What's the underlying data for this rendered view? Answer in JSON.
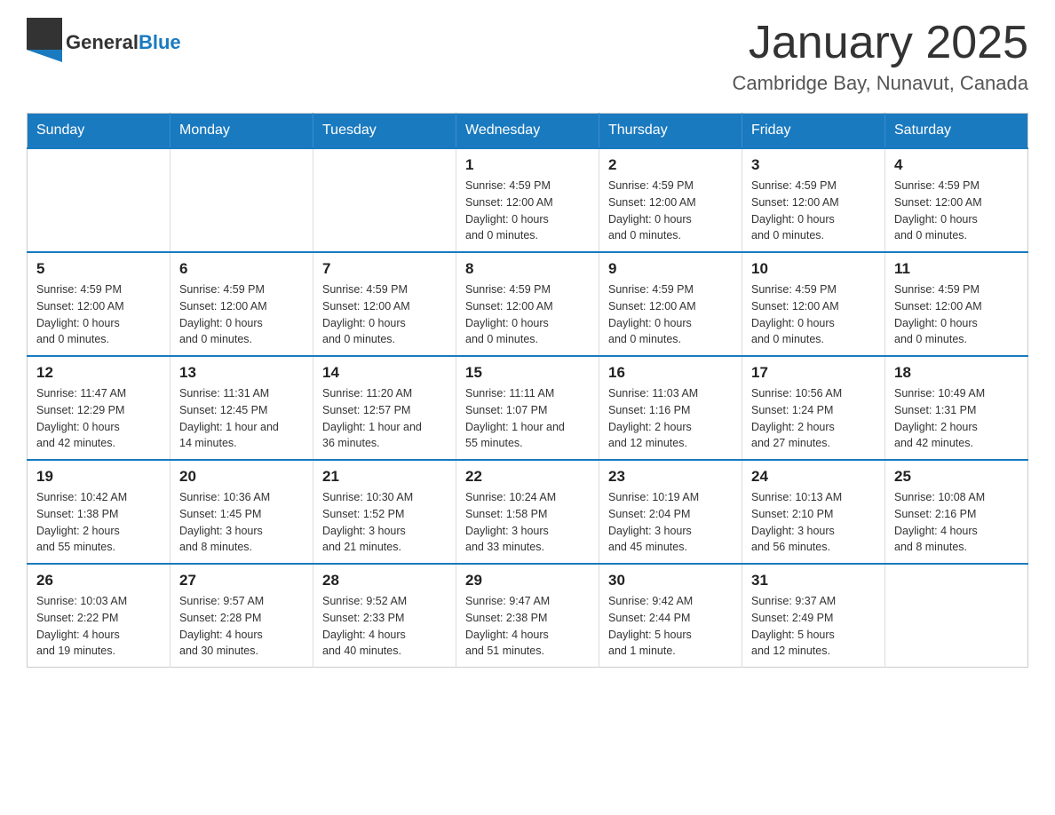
{
  "header": {
    "logo_general": "General",
    "logo_blue": "Blue",
    "title": "January 2025",
    "subtitle": "Cambridge Bay, Nunavut, Canada"
  },
  "weekdays": [
    "Sunday",
    "Monday",
    "Tuesday",
    "Wednesday",
    "Thursday",
    "Friday",
    "Saturday"
  ],
  "weeks": [
    [
      {
        "day": "",
        "info": ""
      },
      {
        "day": "",
        "info": ""
      },
      {
        "day": "",
        "info": ""
      },
      {
        "day": "1",
        "info": "Sunrise: 4:59 PM\nSunset: 12:00 AM\nDaylight: 0 hours\nand 0 minutes."
      },
      {
        "day": "2",
        "info": "Sunrise: 4:59 PM\nSunset: 12:00 AM\nDaylight: 0 hours\nand 0 minutes."
      },
      {
        "day": "3",
        "info": "Sunrise: 4:59 PM\nSunset: 12:00 AM\nDaylight: 0 hours\nand 0 minutes."
      },
      {
        "day": "4",
        "info": "Sunrise: 4:59 PM\nSunset: 12:00 AM\nDaylight: 0 hours\nand 0 minutes."
      }
    ],
    [
      {
        "day": "5",
        "info": "Sunrise: 4:59 PM\nSunset: 12:00 AM\nDaylight: 0 hours\nand 0 minutes."
      },
      {
        "day": "6",
        "info": "Sunrise: 4:59 PM\nSunset: 12:00 AM\nDaylight: 0 hours\nand 0 minutes."
      },
      {
        "day": "7",
        "info": "Sunrise: 4:59 PM\nSunset: 12:00 AM\nDaylight: 0 hours\nand 0 minutes."
      },
      {
        "day": "8",
        "info": "Sunrise: 4:59 PM\nSunset: 12:00 AM\nDaylight: 0 hours\nand 0 minutes."
      },
      {
        "day": "9",
        "info": "Sunrise: 4:59 PM\nSunset: 12:00 AM\nDaylight: 0 hours\nand 0 minutes."
      },
      {
        "day": "10",
        "info": "Sunrise: 4:59 PM\nSunset: 12:00 AM\nDaylight: 0 hours\nand 0 minutes."
      },
      {
        "day": "11",
        "info": "Sunrise: 4:59 PM\nSunset: 12:00 AM\nDaylight: 0 hours\nand 0 minutes."
      }
    ],
    [
      {
        "day": "12",
        "info": "Sunrise: 11:47 AM\nSunset: 12:29 PM\nDaylight: 0 hours\nand 42 minutes."
      },
      {
        "day": "13",
        "info": "Sunrise: 11:31 AM\nSunset: 12:45 PM\nDaylight: 1 hour and\n14 minutes."
      },
      {
        "day": "14",
        "info": "Sunrise: 11:20 AM\nSunset: 12:57 PM\nDaylight: 1 hour and\n36 minutes."
      },
      {
        "day": "15",
        "info": "Sunrise: 11:11 AM\nSunset: 1:07 PM\nDaylight: 1 hour and\n55 minutes."
      },
      {
        "day": "16",
        "info": "Sunrise: 11:03 AM\nSunset: 1:16 PM\nDaylight: 2 hours\nand 12 minutes."
      },
      {
        "day": "17",
        "info": "Sunrise: 10:56 AM\nSunset: 1:24 PM\nDaylight: 2 hours\nand 27 minutes."
      },
      {
        "day": "18",
        "info": "Sunrise: 10:49 AM\nSunset: 1:31 PM\nDaylight: 2 hours\nand 42 minutes."
      }
    ],
    [
      {
        "day": "19",
        "info": "Sunrise: 10:42 AM\nSunset: 1:38 PM\nDaylight: 2 hours\nand 55 minutes."
      },
      {
        "day": "20",
        "info": "Sunrise: 10:36 AM\nSunset: 1:45 PM\nDaylight: 3 hours\nand 8 minutes."
      },
      {
        "day": "21",
        "info": "Sunrise: 10:30 AM\nSunset: 1:52 PM\nDaylight: 3 hours\nand 21 minutes."
      },
      {
        "day": "22",
        "info": "Sunrise: 10:24 AM\nSunset: 1:58 PM\nDaylight: 3 hours\nand 33 minutes."
      },
      {
        "day": "23",
        "info": "Sunrise: 10:19 AM\nSunset: 2:04 PM\nDaylight: 3 hours\nand 45 minutes."
      },
      {
        "day": "24",
        "info": "Sunrise: 10:13 AM\nSunset: 2:10 PM\nDaylight: 3 hours\nand 56 minutes."
      },
      {
        "day": "25",
        "info": "Sunrise: 10:08 AM\nSunset: 2:16 PM\nDaylight: 4 hours\nand 8 minutes."
      }
    ],
    [
      {
        "day": "26",
        "info": "Sunrise: 10:03 AM\nSunset: 2:22 PM\nDaylight: 4 hours\nand 19 minutes."
      },
      {
        "day": "27",
        "info": "Sunrise: 9:57 AM\nSunset: 2:28 PM\nDaylight: 4 hours\nand 30 minutes."
      },
      {
        "day": "28",
        "info": "Sunrise: 9:52 AM\nSunset: 2:33 PM\nDaylight: 4 hours\nand 40 minutes."
      },
      {
        "day": "29",
        "info": "Sunrise: 9:47 AM\nSunset: 2:38 PM\nDaylight: 4 hours\nand 51 minutes."
      },
      {
        "day": "30",
        "info": "Sunrise: 9:42 AM\nSunset: 2:44 PM\nDaylight: 5 hours\nand 1 minute."
      },
      {
        "day": "31",
        "info": "Sunrise: 9:37 AM\nSunset: 2:49 PM\nDaylight: 5 hours\nand 12 minutes."
      },
      {
        "day": "",
        "info": ""
      }
    ]
  ]
}
